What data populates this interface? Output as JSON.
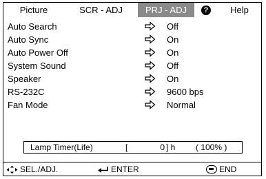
{
  "tabs": [
    {
      "label": "Picture"
    },
    {
      "label": "SCR - ADJ"
    },
    {
      "label": "PRJ - ADJ",
      "active": true
    },
    {
      "label": "?"
    },
    {
      "label": "Help"
    }
  ],
  "settings": [
    {
      "label": "Auto Search",
      "value": "Off"
    },
    {
      "label": "Auto Sync",
      "value": "On"
    },
    {
      "label": "Auto Power Off",
      "value": "On"
    },
    {
      "label": "System Sound",
      "value": "Off"
    },
    {
      "label": "Speaker",
      "value": "On"
    },
    {
      "label": "RS-232C",
      "value": "9600 bps"
    },
    {
      "label": "Fan Mode",
      "value": "Normal"
    }
  ],
  "lamp": {
    "label": "Lamp Timer(Life)",
    "bracket_open": "[",
    "hours": "0",
    "bracket_close": "] h",
    "percent": "( 100% )"
  },
  "footer": {
    "sel_label": "SEL./ADJ.",
    "enter_label": "ENTER",
    "end_label": "END"
  },
  "colors": {
    "active_tab_bg": "#8a8a8a",
    "active_tab_text": "#ffffff",
    "border": "#000000"
  },
  "icons": {
    "row_arrow": "right-arrow-icon",
    "help": "question-icon",
    "sel": "four-way-arrow-icon",
    "enter": "enter-return-icon",
    "end": "end-button-icon"
  }
}
